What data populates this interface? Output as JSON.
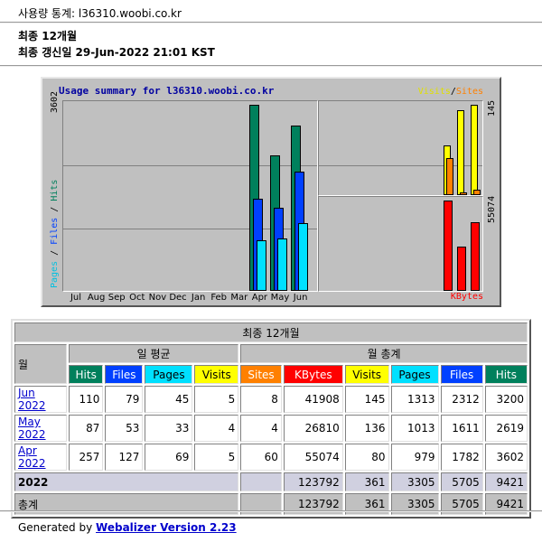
{
  "page": {
    "title": "사용량 통계: l36310.woobi.co.kr",
    "period_line1": "최종 12개월",
    "period_line2": "최종 갱신일 29-Jun-2022 21:01 KST"
  },
  "graph": {
    "title": "Usage summary for l36310.woobi.co.kr",
    "legend_visits": "Visits",
    "legend_sep": "/",
    "legend_sites": "Sites",
    "y_left_max": "3602",
    "y_right_top_max": "145",
    "y_right_bottom_max": "55074",
    "left_axis_pages": "Pages",
    "left_axis_files": "Files",
    "left_axis_hits": "Hits",
    "kbytes_label": "KBytes",
    "months": [
      "Jul",
      "Aug",
      "Sep",
      "Oct",
      "Nov",
      "Dec",
      "Jan",
      "Feb",
      "Mar",
      "Apr",
      "May",
      "Jun"
    ],
    "colors": {
      "hits": "#00805c",
      "files": "#0040ff",
      "pages": "#00e0ff",
      "visits": "#ffff00",
      "sites": "#ff8000",
      "kbytes": "#ff0000"
    }
  },
  "chart_data": {
    "type": "bar",
    "categories": [
      "Jul",
      "Aug",
      "Sep",
      "Oct",
      "Nov",
      "Dec",
      "Jan",
      "Feb",
      "Mar",
      "Apr",
      "May",
      "Jun"
    ],
    "series": [
      {
        "name": "Hits",
        "values": [
          0,
          0,
          0,
          0,
          0,
          0,
          0,
          0,
          0,
          3602,
          2619,
          3200
        ]
      },
      {
        "name": "Files",
        "values": [
          0,
          0,
          0,
          0,
          0,
          0,
          0,
          0,
          0,
          1782,
          1611,
          2312
        ]
      },
      {
        "name": "Pages",
        "values": [
          0,
          0,
          0,
          0,
          0,
          0,
          0,
          0,
          0,
          979,
          1013,
          1313
        ]
      },
      {
        "name": "Visits",
        "values": [
          0,
          0,
          0,
          0,
          0,
          0,
          0,
          0,
          0,
          80,
          136,
          145
        ]
      },
      {
        "name": "Sites",
        "values": [
          0,
          0,
          0,
          0,
          0,
          0,
          0,
          0,
          0,
          60,
          4,
          8
        ]
      },
      {
        "name": "KBytes",
        "values": [
          0,
          0,
          0,
          0,
          0,
          0,
          0,
          0,
          0,
          55074,
          26810,
          41908
        ]
      }
    ]
  },
  "table": {
    "header_title": "최종 12개월",
    "col_month": "월",
    "group_daily": "일 평균",
    "group_monthly": "월 총계",
    "daily_cols": [
      "Hits",
      "Files",
      "Pages",
      "Visits"
    ],
    "monthly_cols": [
      "Sites",
      "KBytes",
      "Visits",
      "Pages",
      "Files",
      "Hits"
    ],
    "rows": [
      {
        "month": "Jun 2022",
        "d_hits": "110",
        "d_files": "79",
        "d_pages": "45",
        "d_visits": "5",
        "sites": "8",
        "kbytes": "41908",
        "visits": "145",
        "pages": "1313",
        "files": "2312",
        "hits": "3200"
      },
      {
        "month": "May 2022",
        "d_hits": "87",
        "d_files": "53",
        "d_pages": "33",
        "d_visits": "4",
        "sites": "4",
        "kbytes": "26810",
        "visits": "136",
        "pages": "1013",
        "files": "1611",
        "hits": "2619"
      },
      {
        "month": "Apr 2022",
        "d_hits": "257",
        "d_files": "127",
        "d_pages": "69",
        "d_visits": "5",
        "sites": "60",
        "kbytes": "55074",
        "visits": "80",
        "pages": "979",
        "files": "1782",
        "hits": "3602"
      }
    ],
    "year_row": {
      "label": "2022",
      "kbytes": "123792",
      "visits": "361",
      "pages": "3305",
      "files": "5705",
      "hits": "9421"
    },
    "total_row": {
      "label": "총계",
      "kbytes": "123792",
      "visits": "361",
      "pages": "3305",
      "files": "5705",
      "hits": "9421"
    }
  },
  "footer": {
    "prefix": "Generated by",
    "link": "Webalizer Version 2.23"
  }
}
